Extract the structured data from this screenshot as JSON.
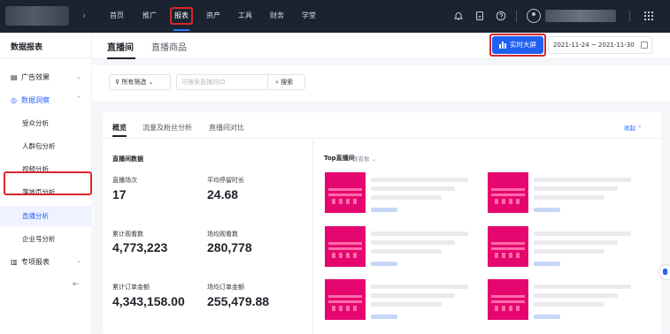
{
  "topnav": {
    "items": [
      {
        "label": "首页"
      },
      {
        "label": "推广"
      },
      {
        "label": "报表"
      },
      {
        "label": "资产"
      },
      {
        "label": "工具"
      },
      {
        "label": "财务"
      },
      {
        "label": "学堂"
      }
    ],
    "active": "报表",
    "icons": [
      "bell-icon",
      "clipboard-icon",
      "help-icon",
      "user-icon",
      "grid-icon"
    ]
  },
  "sidebar": {
    "title": "数据报表",
    "groups": [
      {
        "label": "广告效果",
        "icon": "doc-icon"
      },
      {
        "label": "数据洞察",
        "icon": "insight-icon",
        "expanded": true
      },
      {
        "label": "专项报表",
        "icon": "bar-chart-icon"
      }
    ],
    "items": [
      {
        "label": "受众分析"
      },
      {
        "label": "人群包分析"
      },
      {
        "label": "视频分析"
      },
      {
        "label": "落地页分析"
      },
      {
        "label": "直播分析"
      },
      {
        "label": "企业号分析"
      }
    ],
    "selected": "直播分析"
  },
  "header": {
    "tabs": [
      {
        "label": "直播间"
      },
      {
        "label": "直播商品"
      }
    ],
    "active_tab": "直播间",
    "big_screen_button": "实时大屏",
    "date_range": "2021-11-24 ~ 2021-11-30"
  },
  "filters": {
    "dropdown_label": "所有筛选",
    "search_placeholder": "可搜索直播间ID",
    "search_button": "搜索"
  },
  "card": {
    "tabs": [
      {
        "label": "概览"
      },
      {
        "label": "流量及粉丝分析"
      },
      {
        "label": "直播间对比"
      }
    ],
    "active_tab": "概览",
    "collapse_label": "收起",
    "section_title": "直播间数据",
    "stats": [
      {
        "label": "直播场次",
        "value": "17"
      },
      {
        "label": "平均停留时长",
        "value": "24.68"
      },
      {
        "label": "累计观看数",
        "value": "4,773,223"
      },
      {
        "label": "场均观看数",
        "value": "280,778"
      },
      {
        "label": "累计订单金额",
        "value": "4,343,158.00"
      },
      {
        "label": "场均订单金额",
        "value": "255,479.88"
      }
    ],
    "top_title": "Top直播间",
    "top_sort": "观看数"
  },
  "colors": {
    "nav_bg": "#1b2330",
    "accent": "#2a62ff",
    "button_blue": "#2060f0",
    "highlight_red": "#d8262b",
    "thumb_magenta": "#e5076f"
  }
}
